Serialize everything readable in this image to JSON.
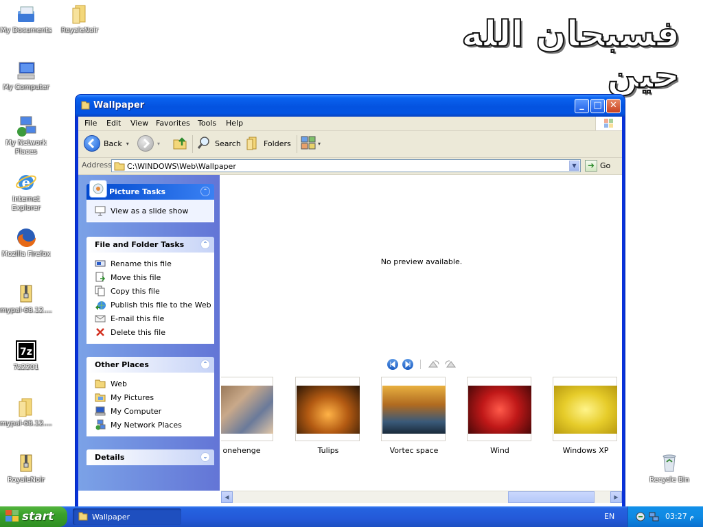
{
  "desktop": {
    "title_text": "فسبحان الله حين",
    "icons": [
      {
        "label": "My Documents"
      },
      {
        "label": "RoyaleNoir"
      },
      {
        "label": "My Computer"
      },
      {
        "label": "My Network Places"
      },
      {
        "label": "Internet Explorer"
      },
      {
        "label": "Mozilla Firefox"
      },
      {
        "label": "mypal-68.12...."
      },
      {
        "label": "7z2201"
      },
      {
        "label": "mypal-68.12...."
      },
      {
        "label": "RoyaleNoir"
      },
      {
        "label": "Recycle Bin"
      }
    ]
  },
  "window": {
    "title": "Wallpaper",
    "controls": {
      "minimize": "_",
      "maximize": "□",
      "close": "✕"
    },
    "menu": [
      "File",
      "Edit",
      "View",
      "Favorites",
      "Tools",
      "Help"
    ],
    "toolbar": {
      "back": "Back",
      "search": "Search",
      "folders": "Folders"
    },
    "address": {
      "label": "Address",
      "path": "C:\\WINDOWS\\Web\\Wallpaper",
      "go": "Go"
    },
    "task_pane": {
      "picture_tasks": {
        "title": "Picture Tasks",
        "items": [
          "View as a slide show"
        ]
      },
      "file_folder_tasks": {
        "title": "File and Folder Tasks",
        "items": [
          "Rename this file",
          "Move this file",
          "Copy this file",
          "Publish this file to the Web",
          "E-mail this file",
          "Delete this file"
        ]
      },
      "other_places": {
        "title": "Other Places",
        "items": [
          "Web",
          "My Pictures",
          "My Computer",
          "My Network Places"
        ]
      },
      "details": {
        "title": "Details"
      }
    },
    "preview": {
      "message": "No preview available."
    },
    "thumbnails": [
      {
        "caption": "onehenge"
      },
      {
        "caption": "Tulips"
      },
      {
        "caption": "Vortec space"
      },
      {
        "caption": "Wind"
      },
      {
        "caption": "Windows XP"
      }
    ]
  },
  "taskbar": {
    "start": "start",
    "task": "Wallpaper",
    "language": "EN",
    "time": "م 03:27"
  },
  "colors": {
    "title_blue": "#0454e2",
    "start_green": "#39a02a",
    "task_link": "#215dc6",
    "pane_blue": "#7ba2e7"
  }
}
